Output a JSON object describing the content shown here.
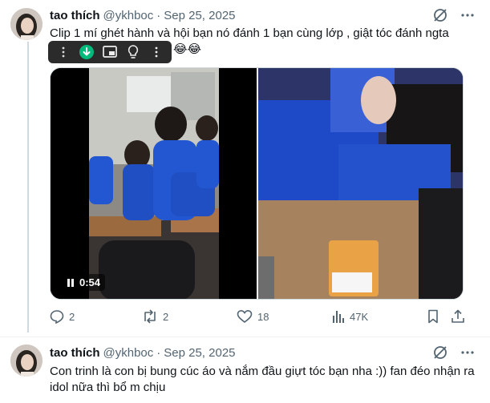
{
  "tweets": [
    {
      "display_name": "tao thích",
      "handle": "@ykhboc",
      "separator": "·",
      "date": "Sep 25, 2025",
      "text": "Clip 1 mí ghét hành và hội bạn nó đánh 1 bạn cùng lớp , giật tóc đánh ngta",
      "emoji": "😂😂",
      "media": {
        "duration": "0:54"
      },
      "stats": {
        "replies": "2",
        "reposts": "2",
        "likes": "18",
        "views": "47K"
      }
    },
    {
      "display_name": "tao thích",
      "handle": "@ykhboc",
      "separator": "·",
      "date": "Sep 25, 2025",
      "text": "Con trinh là con bị bung cúc áo và nắm đầu giựt tóc bạn nha :)) fan đéo nhận ra idol nữa thì bổ m chịu"
    }
  ],
  "icons": {
    "grok": "grok-icon",
    "more": "more-icon",
    "toolbar": [
      "more-vertical-icon",
      "download-icon",
      "pip-icon",
      "bulb-icon",
      "kebab-icon"
    ],
    "actions": [
      "reply-icon",
      "repost-icon",
      "like-icon",
      "views-icon",
      "bookmark-icon",
      "share-icon"
    ]
  },
  "colors": {
    "muted": "#536471",
    "download_green": "#00ba7c",
    "thread_line": "#cfd9de"
  }
}
